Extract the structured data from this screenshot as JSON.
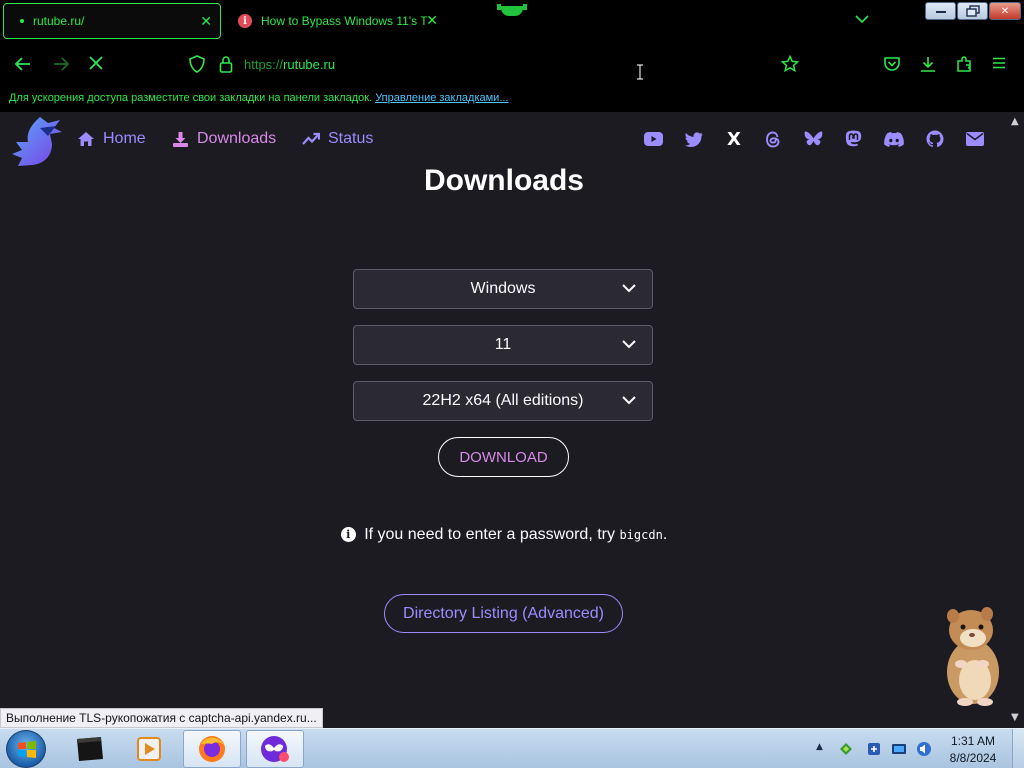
{
  "browser": {
    "tabs": [
      {
        "title": "rutube.ru/",
        "active": true
      },
      {
        "title": "How to Bypass Windows 11's T",
        "active": false
      }
    ],
    "address_protocol": "https://",
    "address_host": "rutube.ru",
    "bookmarks_hint": "Для ускорения доступа разместите свои закладки на панели закладок.",
    "bookmarks_link": "Управление закладками...",
    "status_text": "Выполнение TLS-рукопожатия с captcha-api.yandex.ru...",
    "accent_color": "#2ee84d"
  },
  "site": {
    "nav": {
      "home": "Home",
      "downloads": "Downloads",
      "status": "Status"
    },
    "social_icons": [
      "youtube-icon",
      "twitter-icon",
      "x-icon",
      "threads-icon",
      "bluesky-icon",
      "mastodon-icon",
      "discord-icon",
      "github-icon",
      "mail-icon"
    ],
    "x_glyph": "X",
    "title": "Downloads",
    "selects": {
      "os": "Windows",
      "version": "11",
      "edition": "22H2 x64 (All editions)"
    },
    "download_label": "DOWNLOAD",
    "hint_before": "If you need to enter a password, try",
    "hint_code": "bigcdn",
    "hint_after": ".",
    "info_glyph": "i",
    "directory_label": "Directory Listing (Advanced)",
    "link_color": "#9b8cff",
    "active_color": "#d78ae6"
  },
  "taskbar": {
    "time": "1:31 AM",
    "date": "8/8/2024"
  }
}
